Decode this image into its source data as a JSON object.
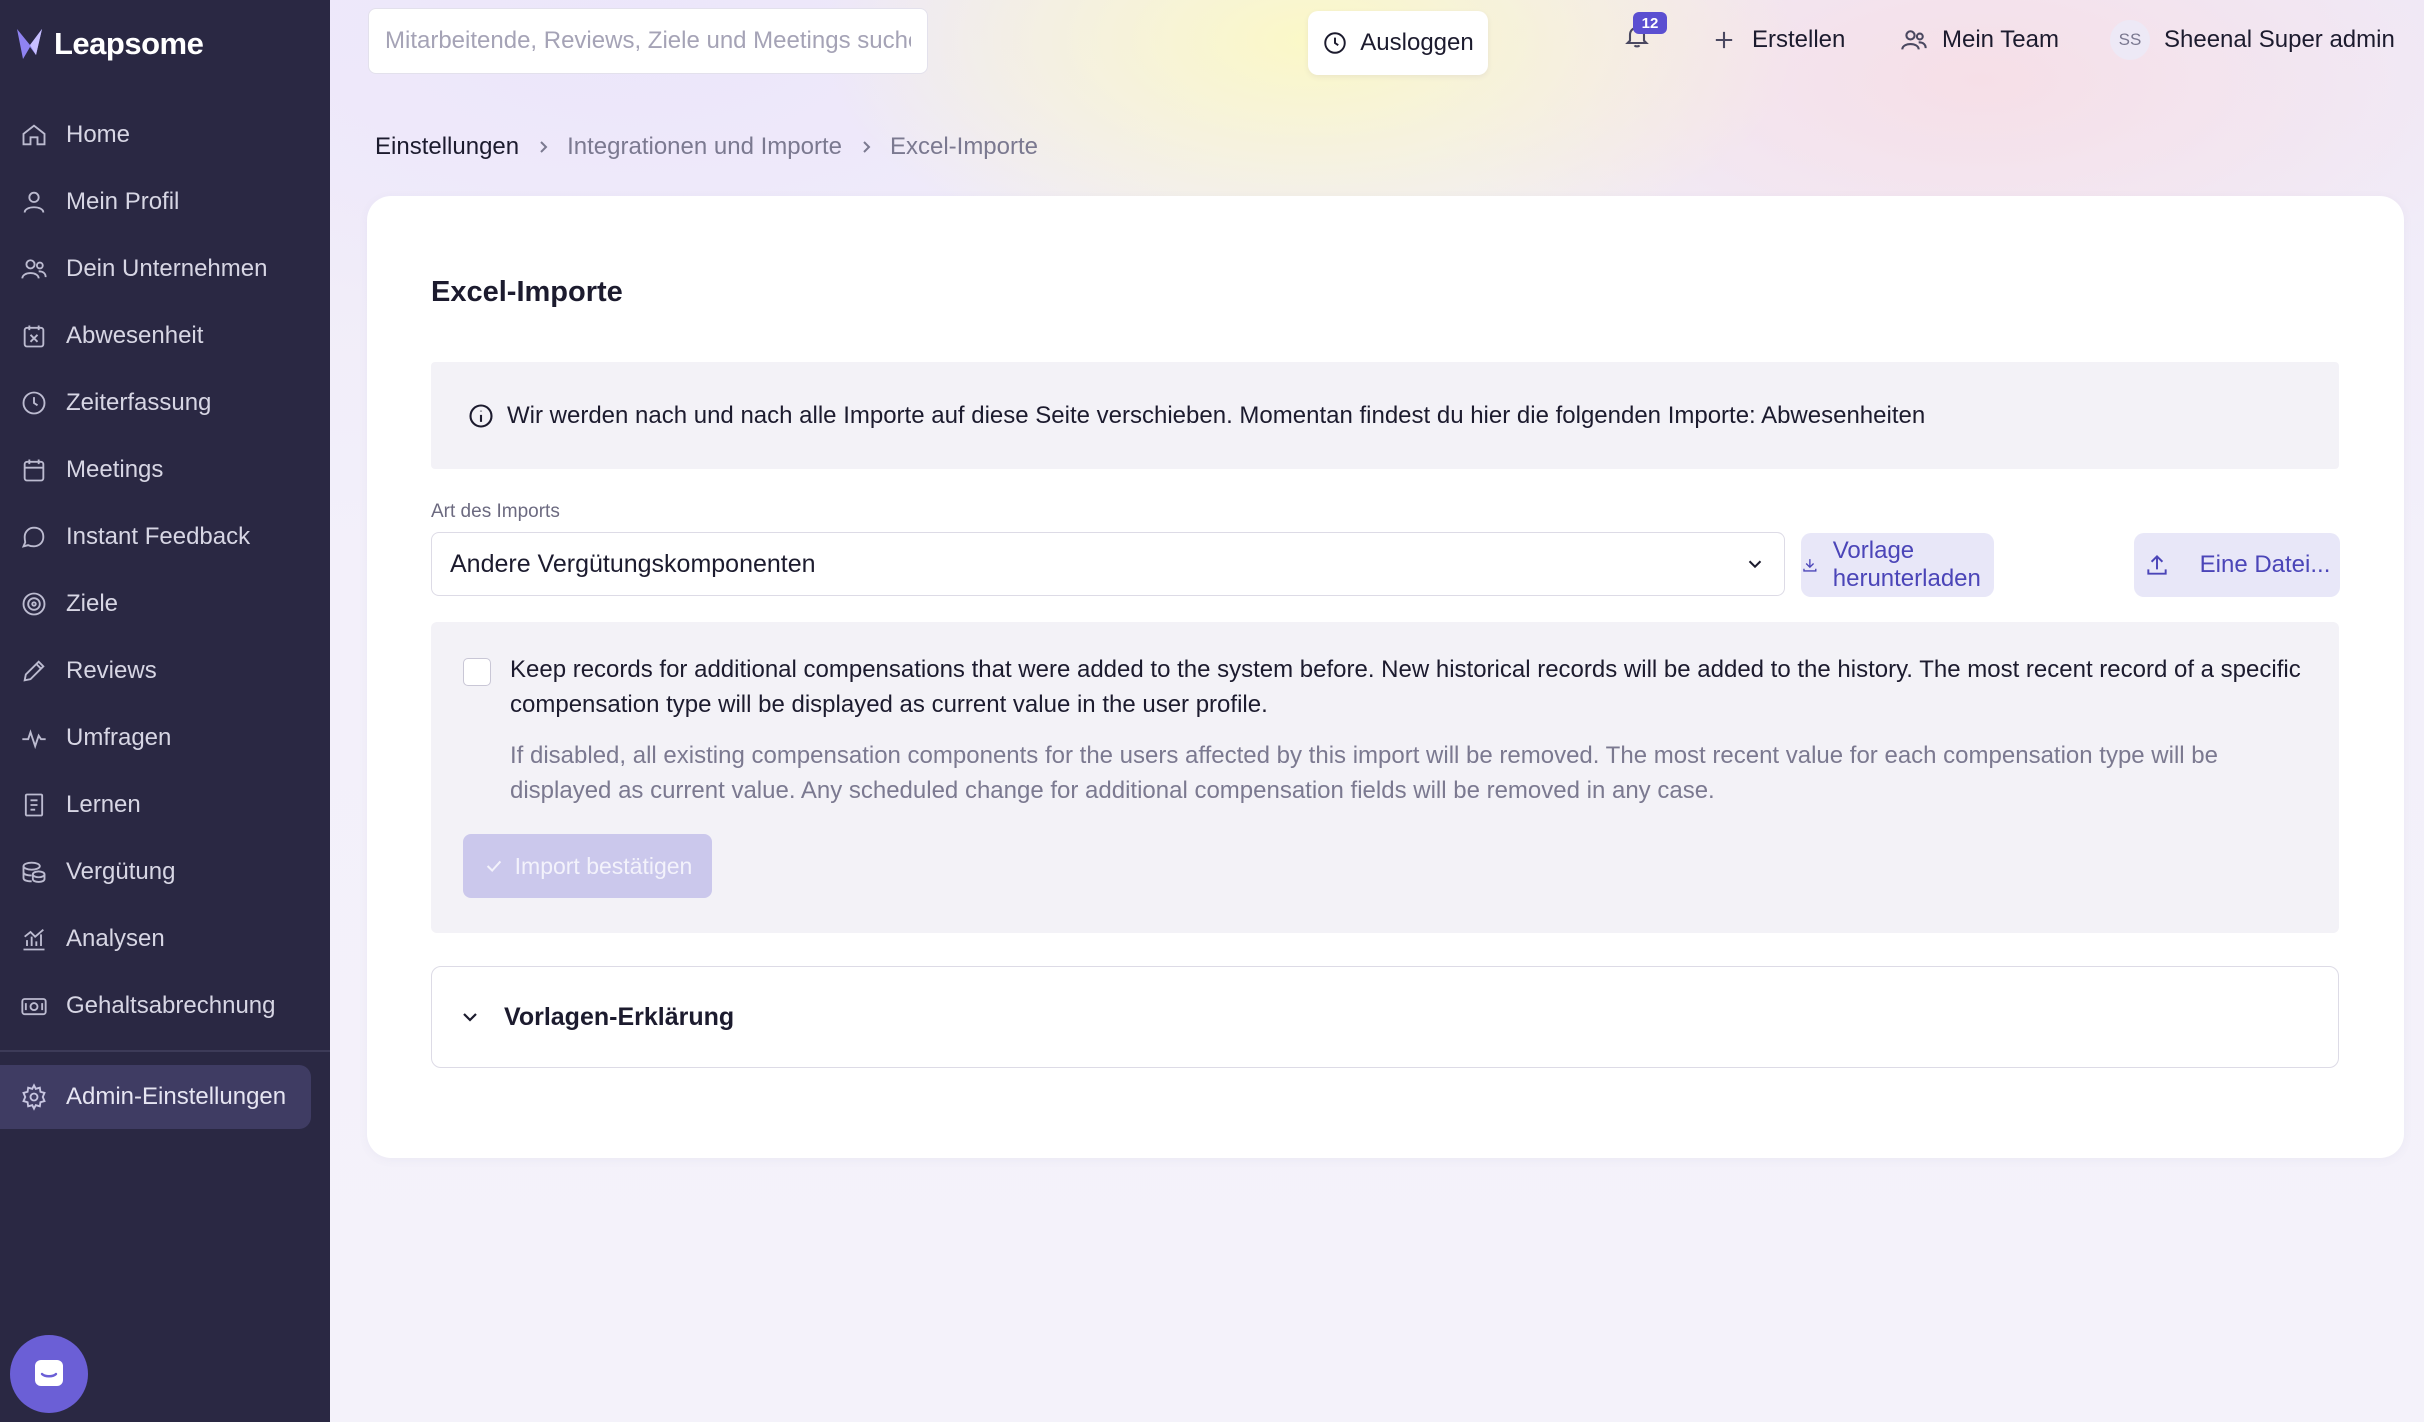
{
  "app": {
    "logo_text": "Leapsome"
  },
  "sidebar": {
    "items": [
      {
        "label": "Home",
        "icon": "home-icon"
      },
      {
        "label": "Mein Profil",
        "icon": "user-icon"
      },
      {
        "label": "Dein Unternehmen",
        "icon": "users-icon"
      },
      {
        "label": "Abwesenheit",
        "icon": "calendar-x-icon"
      },
      {
        "label": "Zeiterfassung",
        "icon": "clock-icon"
      },
      {
        "label": "Meetings",
        "icon": "calendar-icon"
      },
      {
        "label": "Instant Feedback",
        "icon": "chat-icon"
      },
      {
        "label": "Ziele",
        "icon": "target-icon"
      },
      {
        "label": "Reviews",
        "icon": "pen-icon"
      },
      {
        "label": "Umfragen",
        "icon": "pulse-icon"
      },
      {
        "label": "Lernen",
        "icon": "book-icon"
      },
      {
        "label": "Vergütung",
        "icon": "coins-icon"
      },
      {
        "label": "Analysen",
        "icon": "chart-icon"
      },
      {
        "label": "Gehaltsabrechnung",
        "icon": "banknote-icon"
      }
    ],
    "admin": {
      "label": "Admin-Einstellungen",
      "icon": "gear-icon",
      "active": true
    }
  },
  "topbar": {
    "search_placeholder": "Mitarbeitende, Reviews, Ziele und Meetings suchen",
    "logout_label": "Ausloggen",
    "notification_count": "12",
    "create_label": "Erstellen",
    "team_label": "Mein Team",
    "user_initials": "SS",
    "user_name": "Sheenal Super admin"
  },
  "breadcrumb": {
    "items": [
      "Einstellungen",
      "Integrationen und Importe",
      "Excel-Importe"
    ]
  },
  "page": {
    "title": "Excel-Importe",
    "info_text": "Wir werden nach und nach alle Importe auf diese Seite verschieben. Momentan findest du hier die folgenden Importe: Abwesenheiten",
    "import_type_label": "Art des Imports",
    "import_type_value": "Andere Vergütungskomponenten",
    "download_template_label": "Vorlage herunterladen",
    "upload_file_label": "Eine Datei...",
    "keep_records_checked": false,
    "keep_records_text": "Keep records for additional compensations that were added to the system before. New historical records will be added to the history. The most recent record of a specific compensation type will be displayed as current value in the user profile.",
    "keep_records_hint": "If disabled, all existing compensation components for the users affected by this import will be removed. The most recent value for each compensation type will be displayed as current value. Any scheduled change for additional compensation fields will be removed in any case.",
    "confirm_label": "Import bestätigen",
    "accordion_label": "Vorlagen-Erklärung"
  },
  "colors": {
    "sidebar_bg": "#2a2843",
    "accent": "#5b4fd1",
    "secondary_button_bg": "#e8e7f8",
    "disabled_button_bg": "#cbc8ec"
  }
}
